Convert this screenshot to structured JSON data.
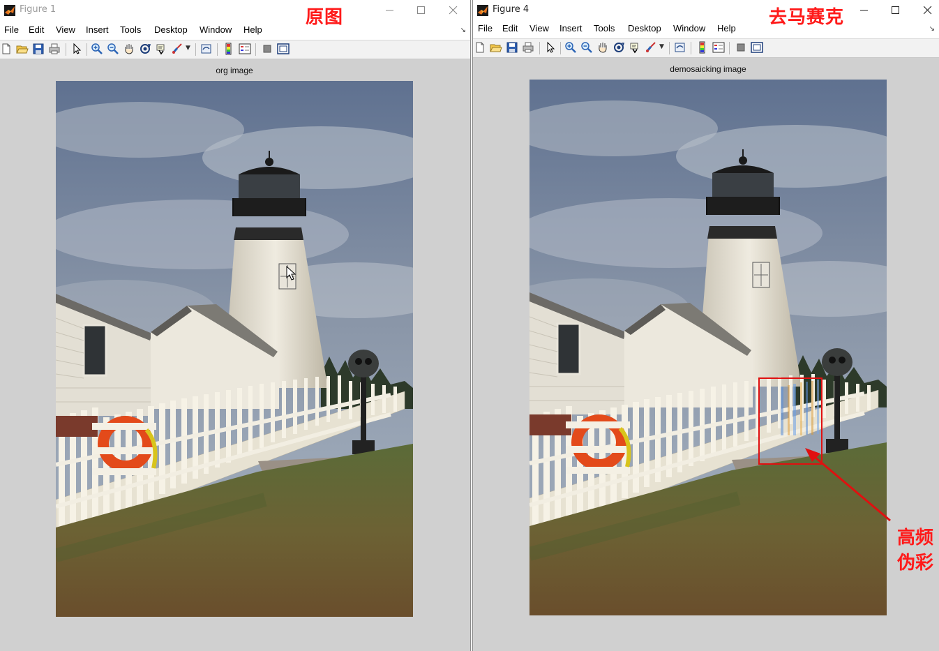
{
  "windows": [
    {
      "id": "left",
      "title": "Figure 1",
      "annotation": "原图",
      "menu": [
        "File",
        "Edit",
        "View",
        "Insert",
        "Tools",
        "Desktop",
        "Window",
        "Help"
      ],
      "axes_title": "org image"
    },
    {
      "id": "right",
      "title": "Figure 4",
      "annotation": "去马赛克",
      "menu": [
        "File",
        "Edit",
        "View",
        "Insert",
        "Tools",
        "Desktop",
        "Window",
        "Help"
      ],
      "axes_title": "demosaicking image"
    }
  ],
  "callout": {
    "line1": "高频",
    "line2": "伪彩"
  },
  "toolbar_icons": [
    "new-figure-icon",
    "open-file-icon",
    "save-icon",
    "print-icon",
    "pointer-icon",
    "zoom-in-icon",
    "zoom-out-icon",
    "pan-icon",
    "rotate-3d-icon",
    "data-cursor-icon",
    "brush-icon",
    "link-plot-icon",
    "colorbar-icon",
    "legend-icon",
    "hide-plot-tools-icon",
    "show-plot-tools-icon"
  ],
  "colors": {
    "annotation_red": "#ff1a1a",
    "figure_bg": "#d0d0d0",
    "toolbar_bg": "#f2f2f2"
  }
}
